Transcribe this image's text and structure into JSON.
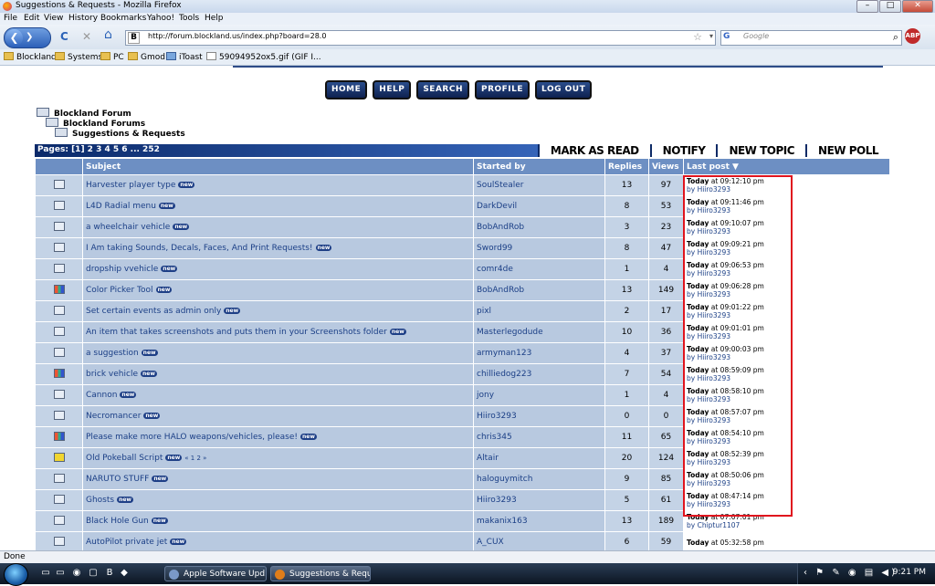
{
  "window": {
    "title": "Suggestions & Requests - Mozilla Firefox",
    "controls": [
      "–",
      "□",
      "✕"
    ]
  },
  "menu": [
    "File",
    "Edit",
    "View",
    "History",
    "Bookmarks",
    "Yahoo!",
    "Tools",
    "Help"
  ],
  "nav": {
    "back_glyph": "❮",
    "forward_glyph": "❯",
    "reload_glyph": "C",
    "stop_glyph": "✕",
    "home_glyph": "⌂",
    "site_glyph": "B",
    "url": "http://forum.blockland.us/index.php?board=28.0",
    "star_glyph": "☆",
    "dropdown_glyph": "▾",
    "search_engine": "G",
    "search_placeholder": "Google",
    "search_glyph": "⌕",
    "abp_label": "ABP"
  },
  "bookmarks": [
    "Blockland",
    "Systems",
    "PC",
    "Gmod",
    "iToast",
    "59094952ox5.gif (GIF I..."
  ],
  "forum_nav": [
    "HOME",
    "HELP",
    "SEARCH",
    "PROFILE",
    "LOG OUT"
  ],
  "breadcrumb": [
    "Blockland Forum",
    "Blockland Forums",
    "Suggestions & Requests"
  ],
  "pages_text": "Pages: [1] 2 3 4 5 6 ... 252",
  "actions": [
    "MARK AS READ",
    "NOTIFY",
    "NEW TOPIC",
    "NEW POLL"
  ],
  "table_headers": {
    "subject": "Subject",
    "started_by": "Started by",
    "replies": "Replies",
    "views": "Views",
    "last_post": "Last post ▼"
  },
  "new_badge": "new",
  "topics": [
    {
      "icon": "folder",
      "subject": "Harvester player type",
      "started_by": "SoulStealer",
      "replies": "13",
      "views": "97",
      "last_day": "Today",
      "last_time": "at 09:12:10 pm",
      "last_by": "by Hiiro3293"
    },
    {
      "icon": "folder",
      "subject": "L4D Radial menu",
      "started_by": "DarkDevil",
      "replies": "8",
      "views": "53",
      "last_day": "Today",
      "last_time": "at 09:11:46 pm",
      "last_by": "by Hiiro3293"
    },
    {
      "icon": "folder",
      "subject": "a wheelchair vehicle",
      "started_by": "BobAndRob",
      "replies": "3",
      "views": "23",
      "last_day": "Today",
      "last_time": "at 09:10:07 pm",
      "last_by": "by Hiiro3293"
    },
    {
      "icon": "folder",
      "subject": "I Am taking Sounds, Decals, Faces, And Print Requests!",
      "started_by": "Sword99",
      "replies": "8",
      "views": "47",
      "last_day": "Today",
      "last_time": "at 09:09:21 pm",
      "last_by": "by Hiiro3293"
    },
    {
      "icon": "folder",
      "subject": "dropship vvehicle",
      "started_by": "comr4de",
      "replies": "1",
      "views": "4",
      "last_day": "Today",
      "last_time": "at 09:06:53 pm",
      "last_by": "by Hiiro3293"
    },
    {
      "icon": "hot",
      "subject": "Color Picker Tool",
      "started_by": "BobAndRob",
      "replies": "13",
      "views": "149",
      "last_day": "Today",
      "last_time": "at 09:06:28 pm",
      "last_by": "by Hiiro3293"
    },
    {
      "icon": "folder",
      "subject": "Set certain events as admin only",
      "started_by": "pixl",
      "replies": "2",
      "views": "17",
      "last_day": "Today",
      "last_time": "at 09:01:22 pm",
      "last_by": "by Hiiro3293"
    },
    {
      "icon": "folder",
      "subject": "An item that takes screenshots and puts them in your Screenshots folder",
      "started_by": "Masterlegodude",
      "replies": "10",
      "views": "36",
      "last_day": "Today",
      "last_time": "at 09:01:01 pm",
      "last_by": "by Hiiro3293"
    },
    {
      "icon": "folder",
      "subject": "a suggestion",
      "started_by": "armyman123",
      "replies": "4",
      "views": "37",
      "last_day": "Today",
      "last_time": "at 09:00:03 pm",
      "last_by": "by Hiiro3293"
    },
    {
      "icon": "hot",
      "subject": "brick vehicle",
      "started_by": "chilliedog223",
      "replies": "7",
      "views": "54",
      "last_day": "Today",
      "last_time": "at 08:59:09 pm",
      "last_by": "by Hiiro3293"
    },
    {
      "icon": "folder",
      "subject": "Cannon",
      "started_by": "jony",
      "replies": "1",
      "views": "4",
      "last_day": "Today",
      "last_time": "at 08:58:10 pm",
      "last_by": "by Hiiro3293"
    },
    {
      "icon": "folder",
      "subject": "Necromancer",
      "started_by": "Hiiro3293",
      "replies": "0",
      "views": "0",
      "last_day": "Today",
      "last_time": "at 08:57:07 pm",
      "last_by": "by Hiiro3293"
    },
    {
      "icon": "hot",
      "subject": "Please make more HALO weapons/vehicles, please!",
      "started_by": "chris345",
      "replies": "11",
      "views": "65",
      "last_day": "Today",
      "last_time": "at 08:54:10 pm",
      "last_by": "by Hiiro3293"
    },
    {
      "icon": "lock",
      "subject": "Old Pokeball Script",
      "pages": "« 1 2 »",
      "started_by": "Altair",
      "replies": "20",
      "views": "124",
      "last_day": "Today",
      "last_time": "at 08:52:39 pm",
      "last_by": "by Hiiro3293"
    },
    {
      "icon": "folder",
      "subject": "NARUTO STUFF",
      "started_by": "haloguymitch",
      "replies": "9",
      "views": "85",
      "last_day": "Today",
      "last_time": "at 08:50:06 pm",
      "last_by": "by Hiiro3293"
    },
    {
      "icon": "folder",
      "subject": "Ghosts",
      "started_by": "Hiiro3293",
      "replies": "5",
      "views": "61",
      "last_day": "Today",
      "last_time": "at 08:47:14 pm",
      "last_by": "by Hiiro3293"
    },
    {
      "icon": "folder",
      "subject": "Black Hole Gun",
      "started_by": "makanix163",
      "replies": "13",
      "views": "189",
      "last_day": "Today",
      "last_time": "at 07:07:01 pm",
      "last_by": "by Chiptur1107"
    },
    {
      "icon": "folder",
      "subject": "AutoPilot private jet",
      "started_by": "A_CUX",
      "replies": "6",
      "views": "59",
      "last_day": "Today",
      "last_time": "at 05:32:58 pm",
      "last_by": ""
    }
  ],
  "status": "Done",
  "taskbar": {
    "quick_launch": [
      "▭",
      "▭",
      "◉",
      "▢",
      "B",
      "◆"
    ],
    "buttons": [
      "Apple Software Upd...",
      "Suggestions & Requ..."
    ],
    "tray_icons": "‹ ⚑ ✎ ◉ ▤ ◀)",
    "clock": "9:21 PM"
  },
  "colors": {
    "header_blue": "#6d8fc3",
    "cell_blue": "#b8c9e0",
    "link_blue": "#1b3f86",
    "highlight_red": "#e0141e"
  }
}
